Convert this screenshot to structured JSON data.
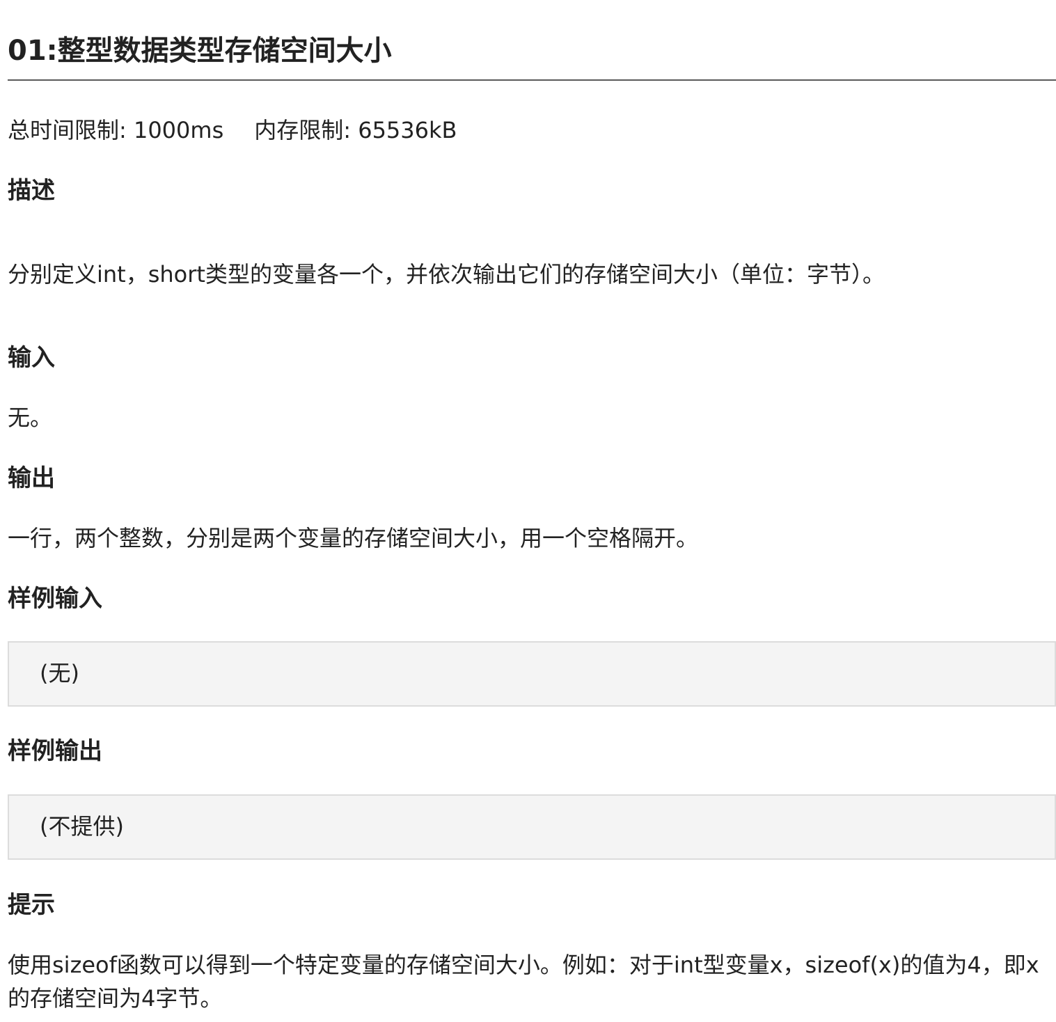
{
  "problem": {
    "title": "01:整型数据类型存储空间大小",
    "time_limit": "总时间限制: 1000ms",
    "memory_limit": "内存限制: 65536kB"
  },
  "sections": {
    "description": {
      "heading": "描述",
      "text": "分别定义int，short类型的变量各一个，并依次输出它们的存储空间大小（单位：字节）。"
    },
    "input": {
      "heading": "输入",
      "text": "无。"
    },
    "output": {
      "heading": "输出",
      "text": "一行，两个整数，分别是两个变量的存储空间大小，用一个空格隔开。"
    },
    "sample_input": {
      "heading": "样例输入",
      "content": "(无)"
    },
    "sample_output": {
      "heading": "样例输出",
      "content": "(不提供)"
    },
    "hint": {
      "heading": "提示",
      "text": "使用sizeof函数可以得到一个特定变量的存储空间大小。例如：对于int型变量x，sizeof(x)的值为4，即x的存储空间为4字节。"
    }
  }
}
